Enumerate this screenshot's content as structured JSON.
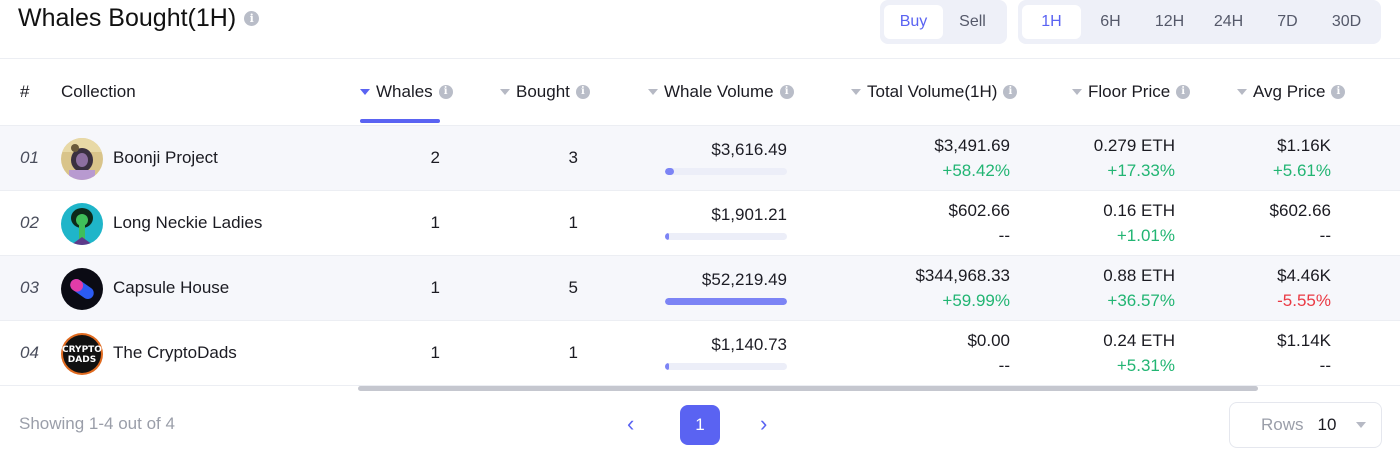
{
  "title": "Whales Bought(1H)",
  "side_toggle": {
    "options": [
      "Buy",
      "Sell"
    ],
    "active": "Buy"
  },
  "period_toggle": {
    "options": [
      "1H",
      "6H",
      "12H",
      "24H",
      "7D",
      "30D"
    ],
    "active": "1H"
  },
  "columns": {
    "rank": "#",
    "collection": "Collection",
    "whales": "Whales",
    "bought": "Bought",
    "whale_volume": "Whale Volume",
    "total_volume": "Total Volume(1H)",
    "floor_price": "Floor Price",
    "avg_price": "Avg Price"
  },
  "sorted_by": "Whales",
  "rows": [
    {
      "rank": "01",
      "name": "Boonji Project",
      "avatar": "boonji-avatar-icon",
      "whales": "2",
      "bought": "3",
      "whale_volume": "$3,616.49",
      "whale_volume_fraction": 0.07,
      "total_volume": "$3,491.69",
      "total_change": "+58.42%",
      "total_dir": "pos",
      "floor": "0.279 ETH",
      "floor_change": "+17.33%",
      "floor_dir": "pos",
      "avg": "$1.16K",
      "avg_change": "+5.61%",
      "avg_dir": "pos"
    },
    {
      "rank": "02",
      "name": "Long Neckie Ladies",
      "avatar": "long-neckie-avatar-icon",
      "whales": "1",
      "bought": "1",
      "whale_volume": "$1,901.21",
      "whale_volume_fraction": 0.036,
      "total_volume": "$602.66",
      "total_change": "--",
      "total_dir": "none",
      "floor": "0.16 ETH",
      "floor_change": "+1.01%",
      "floor_dir": "pos",
      "avg": "$602.66",
      "avg_change": "--",
      "avg_dir": "none"
    },
    {
      "rank": "03",
      "name": "Capsule House",
      "avatar": "capsule-house-avatar-icon",
      "whales": "1",
      "bought": "5",
      "whale_volume": "$52,219.49",
      "whale_volume_fraction": 1.0,
      "total_volume": "$344,968.33",
      "total_change": "+59.99%",
      "total_dir": "pos",
      "floor": "0.88 ETH",
      "floor_change": "+36.57%",
      "floor_dir": "pos",
      "avg": "$4.46K",
      "avg_change": "-5.55%",
      "avg_dir": "neg"
    },
    {
      "rank": "04",
      "name": "The CryptoDads",
      "avatar": "cryptodads-avatar-icon",
      "whales": "1",
      "bought": "1",
      "whale_volume": "$1,140.73",
      "whale_volume_fraction": 0.022,
      "total_volume": "$0.00",
      "total_change": "--",
      "total_dir": "none",
      "floor": "0.24 ETH",
      "floor_change": "+5.31%",
      "floor_dir": "pos",
      "avg": "$1.14K",
      "avg_change": "--",
      "avg_dir": "none"
    }
  ],
  "footer": {
    "showing": "Showing 1-4 out of 4",
    "current_page": "1",
    "prev_icon": "‹",
    "next_icon": "›",
    "rows_label": "Rows",
    "rows_value": "10"
  },
  "colors": {
    "accent": "#5a63f2",
    "positive": "#22b573",
    "negative": "#ea3943"
  }
}
